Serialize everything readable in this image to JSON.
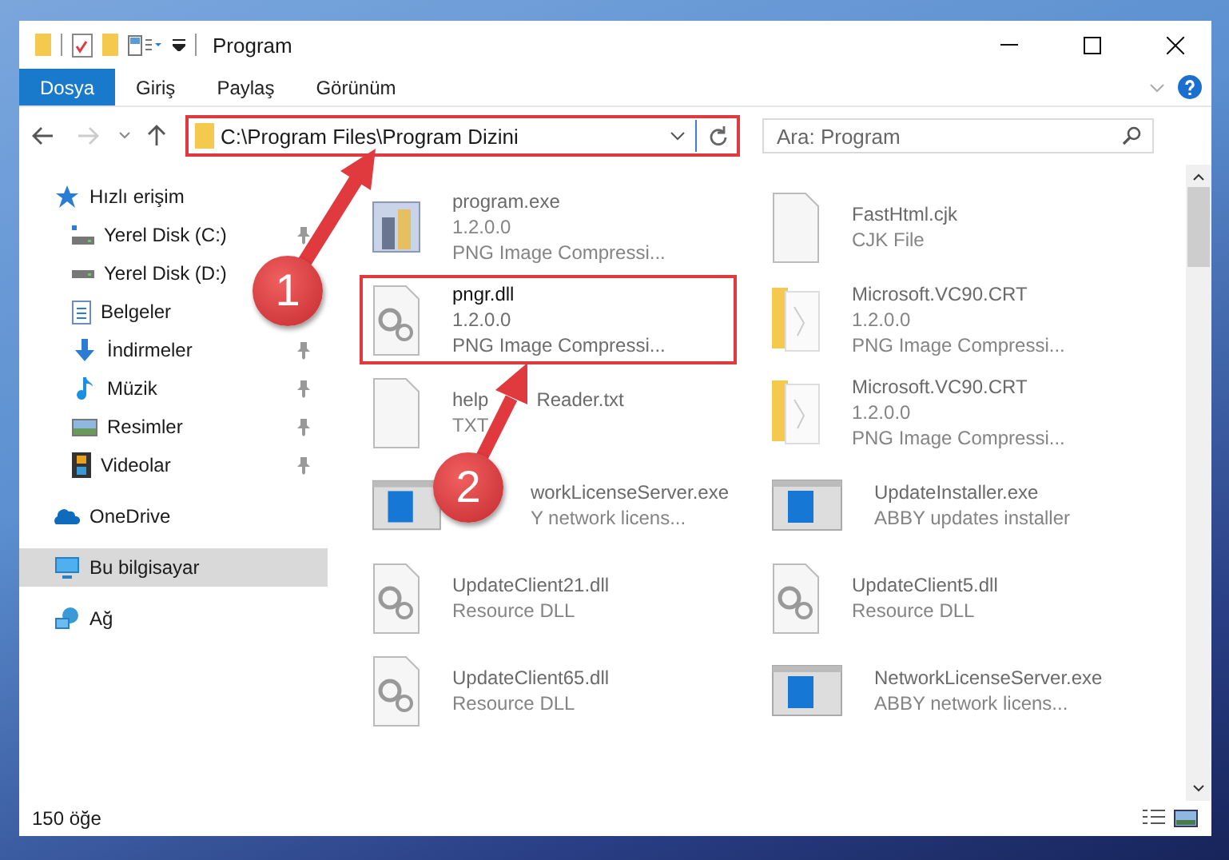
{
  "window": {
    "title": "Program"
  },
  "ribbon_tabs": [
    {
      "label": "Dosya",
      "selected": true
    },
    {
      "label": "Giriş",
      "selected": false
    },
    {
      "label": "Paylaş",
      "selected": false
    },
    {
      "label": "Görünüm",
      "selected": false
    }
  ],
  "address": {
    "path": "C:\\Program Files\\Program Dizini",
    "highlighted": true
  },
  "search": {
    "placeholder": "Ara: Program"
  },
  "nav": [
    {
      "kind": "quick",
      "label": "Hızlı erişim",
      "pinned": false,
      "selected": false
    },
    {
      "kind": "disk-c",
      "label": "Yerel Disk (C:)",
      "pinned": true,
      "selected": false
    },
    {
      "kind": "disk",
      "label": "Yerel Disk (D:)",
      "pinned": false,
      "selected": false
    },
    {
      "kind": "docs",
      "label": "Belgeler",
      "pinned": false,
      "selected": false
    },
    {
      "kind": "download",
      "label": "İndirmeler",
      "pinned": true,
      "selected": false
    },
    {
      "kind": "music",
      "label": "Müzik",
      "pinned": true,
      "selected": false
    },
    {
      "kind": "pictures",
      "label": "Resimler",
      "pinned": true,
      "selected": false
    },
    {
      "kind": "videos",
      "label": "Videolar",
      "pinned": true,
      "selected": false
    },
    {
      "kind": "onedrive",
      "label": "OneDrive",
      "pinned": false,
      "selected": false
    },
    {
      "kind": "pc",
      "label": "Bu bilgisayar",
      "pinned": false,
      "selected": true
    },
    {
      "kind": "network",
      "label": "Ağ",
      "pinned": false,
      "selected": false
    }
  ],
  "files": [
    {
      "kind": "exe",
      "name": "program.exe",
      "lines": [
        "1.2.0.0",
        "PNG Image Compressi..."
      ],
      "dimmed": true,
      "highlighted": false
    },
    {
      "kind": "blank",
      "name": "FastHtml.cjk",
      "lines": [
        "CJK File"
      ],
      "dimmed": true,
      "highlighted": false
    },
    {
      "kind": "dll",
      "name": "pngr.dll",
      "lines": [
        "1.2.0.0",
        "PNG Image Compressi..."
      ],
      "dimmed": false,
      "highlighted": true
    },
    {
      "kind": "folder",
      "name": "Microsoft.VC90.CRT",
      "lines": [
        "1.2.0.0",
        "PNG Image Compressi..."
      ],
      "dimmed": true,
      "highlighted": false
    },
    {
      "kind": "blank",
      "name": "help",
      "name_tail": "Reader.txt",
      "lines": [
        "TXT"
      ],
      "dimmed": true,
      "highlighted": false
    },
    {
      "kind": "folder",
      "name": "Microsoft.VC90.CRT",
      "lines": [
        "1.2.0.0",
        "PNG Image Compressi..."
      ],
      "dimmed": true,
      "highlighted": false
    },
    {
      "kind": "app",
      "name": "workLicenseServer.exe",
      "lines": [
        "Y network licens..."
      ],
      "dimmed": true,
      "highlighted": false,
      "covered": true
    },
    {
      "kind": "app",
      "name": "UpdateInstaller.exe",
      "lines": [
        "ABBY updates installer"
      ],
      "dimmed": true,
      "highlighted": false
    },
    {
      "kind": "dll",
      "name": "UpdateClient21.dll",
      "lines": [
        "Resource DLL"
      ],
      "dimmed": true,
      "highlighted": false
    },
    {
      "kind": "dll",
      "name": "UpdateClient5.dll",
      "lines": [
        "Resource DLL"
      ],
      "dimmed": true,
      "highlighted": false
    },
    {
      "kind": "dll",
      "name": "UpdateClient65.dll",
      "lines": [
        "Resource DLL"
      ],
      "dimmed": true,
      "highlighted": false
    },
    {
      "kind": "app",
      "name": "NetworkLicenseServer.exe",
      "lines": [
        "ABBY network licens..."
      ],
      "dimmed": true,
      "highlighted": false
    }
  ],
  "status_bar": {
    "count": "150 öğe"
  },
  "callouts": [
    {
      "number": "1"
    },
    {
      "number": "2"
    }
  ]
}
